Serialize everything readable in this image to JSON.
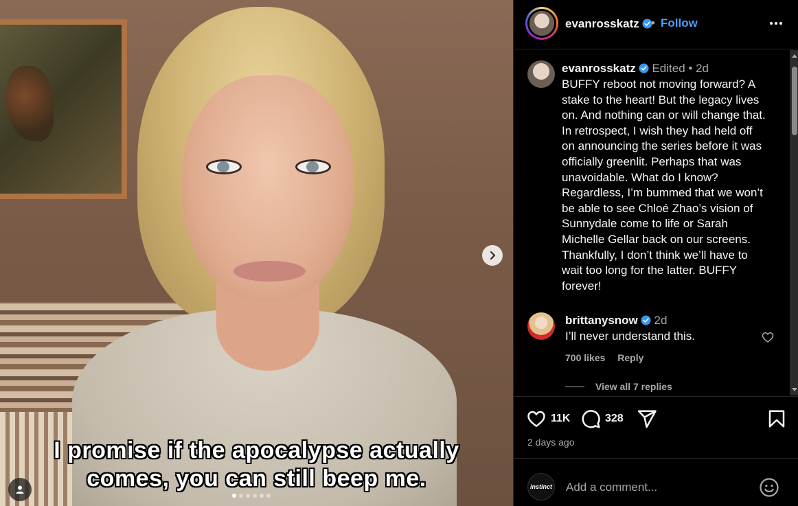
{
  "media": {
    "caption_line1": "I promise if the apocalypse actually",
    "caption_line2": "comes, you can still beep me.",
    "carousel_count": 6,
    "carousel_active": 0
  },
  "header": {
    "username": "evanrosskatz",
    "separator": "•",
    "follow_label": "Follow"
  },
  "post": {
    "username": "evanrosskatz",
    "edited": "Edited",
    "separator": "•",
    "age": "2d",
    "lines": [
      "BUFFY reboot not moving forward? A",
      "stake to the heart! But the legacy lives",
      "on. And nothing can or will change that.",
      "In retrospect, I wish they had held off",
      "on announcing the series before it was",
      "officially greenlit. Perhaps that was",
      "unavoidable. What do I know?",
      "Regardless, I’m bummed that we won’t",
      "be able to see Chloé Zhao’s vision of",
      "Sunnydale come to life or Sarah",
      "Michelle Gellar back on our screens.",
      "Thankfully, I don’t think we’ll have to",
      "wait too long for the latter. BUFFY",
      "forever!"
    ]
  },
  "comment": {
    "username": "brittanysnow",
    "age": "2d",
    "text": "I’ll never understand this.",
    "likes": "700 likes",
    "reply_label": "Reply",
    "view_replies": "View all 7 replies"
  },
  "stats": {
    "likes": "11K",
    "comments": "328",
    "posted": "2 days ago"
  },
  "add_comment": {
    "avatar_text": "instinct",
    "placeholder": "Add a comment..."
  },
  "colors": {
    "background": "#000000",
    "accent_link": "#4f9eff",
    "verified": "#3897f0",
    "muted_text": "#a8a8a8"
  }
}
